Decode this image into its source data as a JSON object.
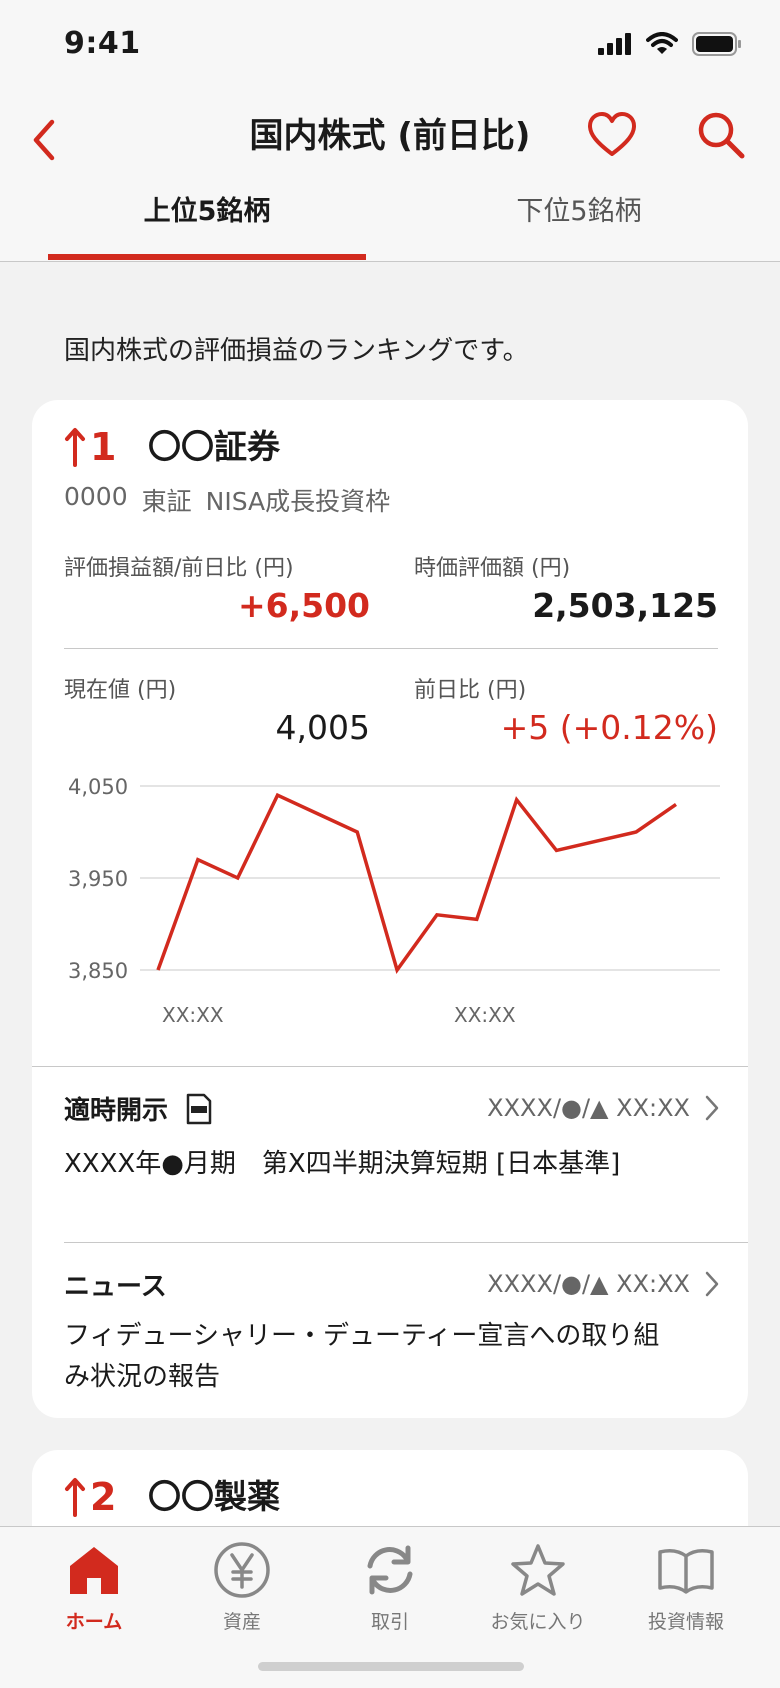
{
  "status_bar": {
    "time": "9:41"
  },
  "header": {
    "title": "国内株式 (前日比)"
  },
  "tabs": [
    {
      "label": "上位5銘柄",
      "active": true
    },
    {
      "label": "下位5銘柄",
      "active": false
    }
  ],
  "intro_text": "国内株式の評価損益のランキングです。",
  "cards": [
    {
      "rank": "1",
      "name": "〇〇証券",
      "code": "0000",
      "market": "東証",
      "account": "NISA成長投資枠",
      "pl_label": "評価損益額/前日比 (円)",
      "pl_value": "+6,500",
      "market_value_label": "時価評価額 (円)",
      "market_value": "2,503,125",
      "current_price_label": "現在値 (円)",
      "current_price": "4,005",
      "change_label": "前日比 (円)",
      "change_value": "+5 (+0.12%)",
      "disclosure_title": "適時開示",
      "disclosure_date": "XXXX/●/▲ XX:XX",
      "disclosure_text": "XXXX年●月期　第X四半期決算短期 [日本基準]",
      "news_title": "ニュース",
      "news_date": "XXXX/●/▲ XX:XX",
      "news_text": "フィデューシャリー・デューティー宣言への取り組み状況の報告"
    },
    {
      "rank": "2",
      "name": "〇〇製薬"
    }
  ],
  "chart_data": {
    "type": "line",
    "ylim": [
      3850,
      4050
    ],
    "yticks": [
      "4,050",
      "3,950",
      "3,850"
    ],
    "xticks": [
      "XX:XX",
      "XX:XX"
    ],
    "grid": true,
    "color": "#d22a1e",
    "values": [
      3850,
      3970,
      3950,
      4040,
      4020,
      4000,
      3850,
      3910,
      3905,
      4035,
      3980,
      3990,
      4000,
      4030
    ]
  },
  "tabbar": [
    {
      "label": "ホーム",
      "icon": "home-icon",
      "active": true
    },
    {
      "label": "資産",
      "icon": "yen-icon",
      "active": false
    },
    {
      "label": "取引",
      "icon": "refresh-icon",
      "active": false
    },
    {
      "label": "お気に入り",
      "icon": "star-icon",
      "active": false
    },
    {
      "label": "投資情報",
      "icon": "book-icon",
      "active": false
    }
  ],
  "colors": {
    "accent": "#d22a1e",
    "background": "#f2f2f2"
  }
}
